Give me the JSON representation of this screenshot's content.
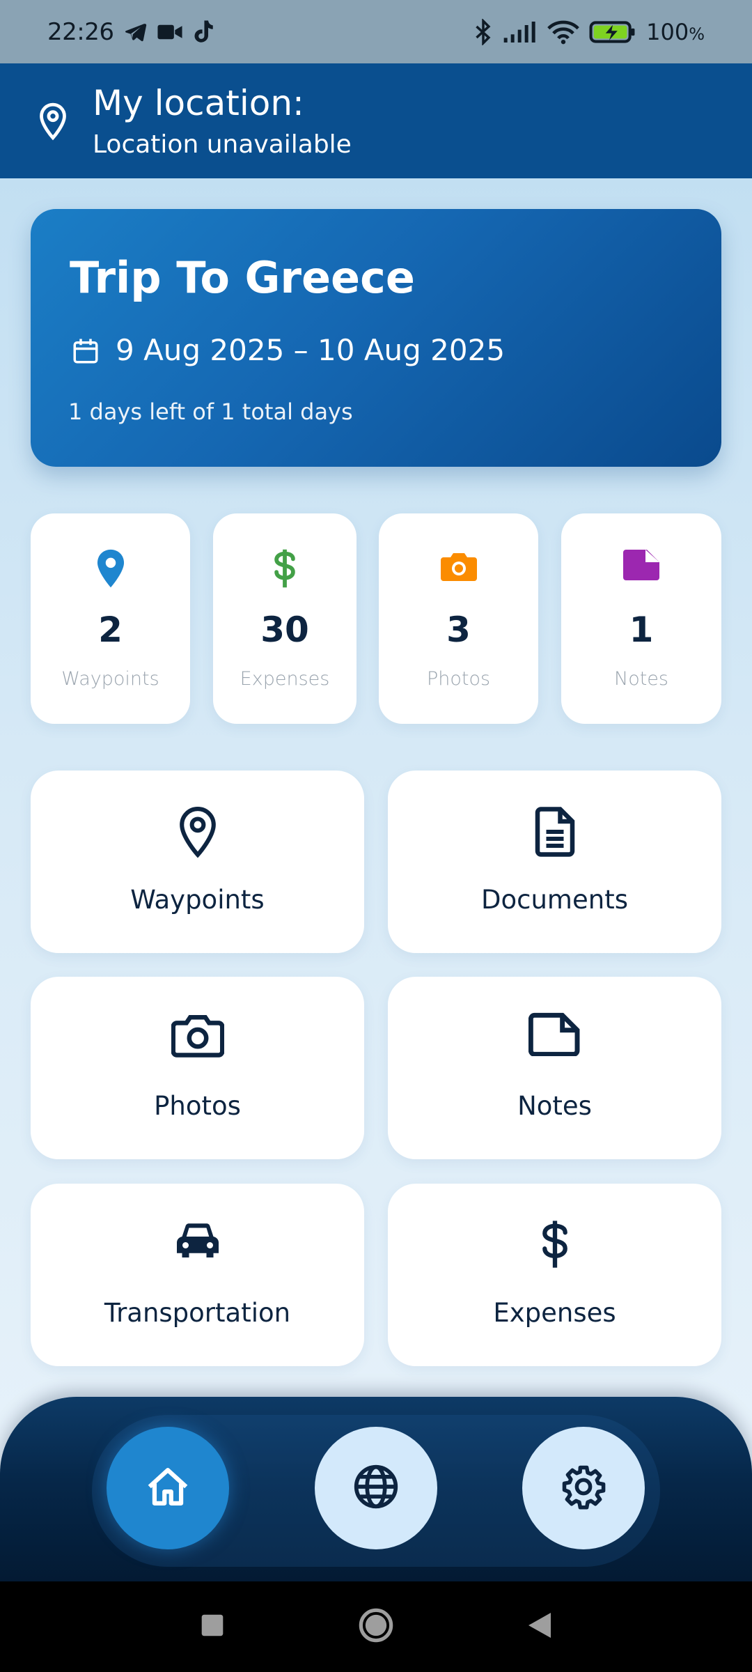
{
  "status_bar": {
    "time": "22:26",
    "battery_percent": "100",
    "battery_unit": "%",
    "left_icons": [
      "telegram-icon",
      "video-camera-icon",
      "tiktok-icon"
    ],
    "right_icons": [
      "bluetooth-icon",
      "signal-icon",
      "wifi-icon",
      "battery-charging-icon"
    ]
  },
  "header": {
    "title": "My location:",
    "subtitle": "Location unavailable"
  },
  "trip": {
    "title": "Trip To Greece",
    "dates": "9 Aug 2025 – 10 Aug 2025",
    "remaining": "1 days left of 1 total days"
  },
  "stats": [
    {
      "value": "2",
      "label": "Waypoints",
      "icon": "location-pin-icon",
      "color": "#1f86cf"
    },
    {
      "value": "30",
      "label": "Expenses",
      "icon": "dollar-icon",
      "color": "#43a047"
    },
    {
      "value": "3",
      "label": "Photos",
      "icon": "camera-icon",
      "color": "#fb8c00"
    },
    {
      "value": "1",
      "label": "Notes",
      "icon": "note-icon",
      "color": "#9c27b0"
    }
  ],
  "tiles": [
    {
      "label": "Waypoints",
      "icon": "location-pin-outline-icon"
    },
    {
      "label": "Documents",
      "icon": "document-icon"
    },
    {
      "label": "Photos",
      "icon": "camera-outline-icon"
    },
    {
      "label": "Notes",
      "icon": "note-outline-icon"
    },
    {
      "label": "Transportation",
      "icon": "car-icon"
    },
    {
      "label": "Expenses",
      "icon": "dollar-icon"
    }
  ],
  "bottom_nav": {
    "items": [
      {
        "id": "home",
        "icon": "home-icon",
        "active": true
      },
      {
        "id": "globe",
        "icon": "globe-icon",
        "active": false
      },
      {
        "id": "settings",
        "icon": "gear-icon",
        "active": false
      }
    ]
  },
  "colors": {
    "primary": "#0a4f8f",
    "accent": "#1f86cf",
    "text_dark": "#0d2440"
  }
}
